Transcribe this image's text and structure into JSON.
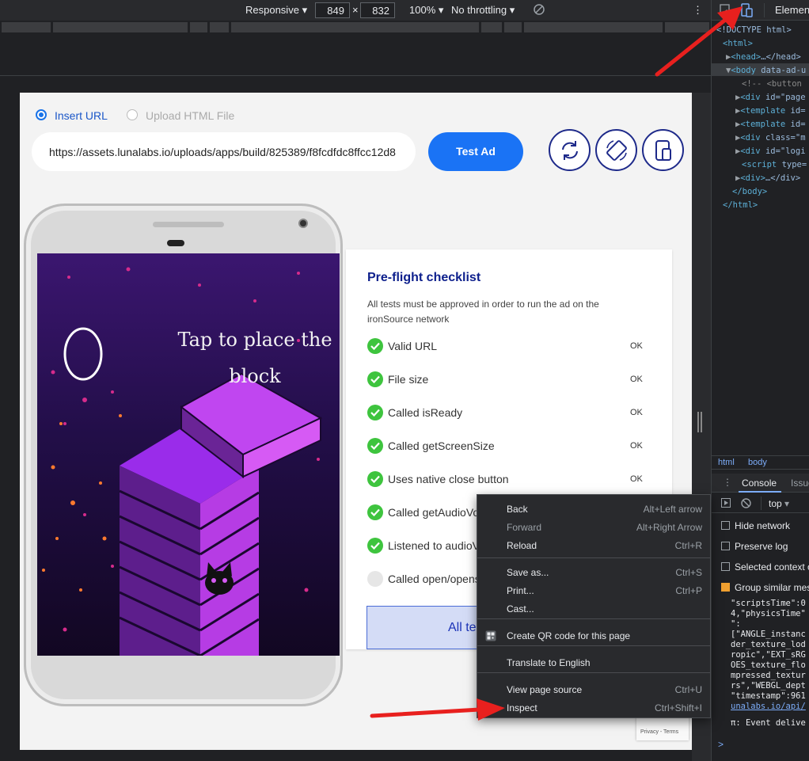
{
  "device_toolbar": {
    "device": "Responsive",
    "width": "849",
    "times": "×",
    "height": "832",
    "zoom": "100%",
    "throttling": "No throttling",
    "more": "⋮"
  },
  "page": {
    "radio_insert_url": "Insert URL",
    "radio_upload_html": "Upload HTML File",
    "url_value": "https://assets.lunalabs.io/uploads/apps/build/825389/f8fcdfdc8ffcc12d8",
    "test_button": "Test Ad",
    "phone_caption": "Tap to place the block",
    "checklist": {
      "title": "Pre-flight checklist",
      "subtitle": "All tests must be approved in order to run the ad on the ironSource network",
      "items": [
        {
          "label": "Valid URL",
          "status": "OK",
          "passed": true
        },
        {
          "label": "File size",
          "status": "OK",
          "passed": true
        },
        {
          "label": "Called isReady",
          "status": "OK",
          "passed": true
        },
        {
          "label": "Called getScreenSize",
          "status": "OK",
          "passed": true
        },
        {
          "label": "Uses native close button",
          "status": "OK",
          "passed": true
        },
        {
          "label": "Called getAudioVo",
          "status": "",
          "passed": true
        },
        {
          "label": "Listened to audioV",
          "status": "",
          "passed": true
        },
        {
          "label": "Called open/opens",
          "status": "",
          "passed": false
        }
      ],
      "all_tests_button": "All te"
    },
    "recaptcha_terms": "Privacy - Terms"
  },
  "context_menu": {
    "items": [
      {
        "label": "Back",
        "shortcut": "Alt+Left arrow"
      },
      {
        "label": "Forward",
        "shortcut": "Alt+Right Arrow",
        "disabled": true
      },
      {
        "label": "Reload",
        "shortcut": "Ctrl+R"
      },
      {
        "label": "Save as...",
        "shortcut": "Ctrl+S"
      },
      {
        "label": "Print...",
        "shortcut": "Ctrl+P"
      },
      {
        "label": "Cast...",
        "shortcut": ""
      },
      {
        "label": "Create QR code for this page",
        "shortcut": ""
      },
      {
        "label": "Translate to English",
        "shortcut": ""
      },
      {
        "label": "View page source",
        "shortcut": "Ctrl+U"
      },
      {
        "label": "Inspect",
        "shortcut": "Ctrl+Shift+I"
      }
    ]
  },
  "devtools": {
    "tab_elements": "Elements",
    "dom_lines": [
      {
        "open": "",
        "tag": "",
        "text": "<!DOCTYPE html>"
      },
      {
        "open": "",
        "tag": "<html>",
        "text": ""
      },
      {
        "open": "▶",
        "tag": "<head>",
        "text": "…</head>"
      },
      {
        "open": "▼",
        "tag": "<body",
        "text": " data-ad-u"
      },
      {
        "open": "",
        "tag": "",
        "text": "<!-- <button"
      },
      {
        "open": "▶",
        "tag": "<div",
        "text": " id=\"page"
      },
      {
        "open": "▶",
        "tag": "<template",
        "text": " id="
      },
      {
        "open": "▶",
        "tag": "<template",
        "text": " id="
      },
      {
        "open": "▶",
        "tag": "<div",
        "text": " class=\"m"
      },
      {
        "open": "▶",
        "tag": "<div",
        "text": " id=\"logi"
      },
      {
        "open": "",
        "tag": "<script",
        "text": " type="
      },
      {
        "open": "▶",
        "tag": "<div>",
        "text": "…</div>"
      },
      {
        "open": "",
        "tag": "</body>",
        "text": ""
      },
      {
        "open": "",
        "tag": "</html>",
        "text": ""
      }
    ],
    "crumbs": [
      "html",
      "body"
    ],
    "console_tab": "Console",
    "issues_tab": "Issue",
    "context": "top",
    "checkboxes": [
      {
        "label": "Hide network",
        "checked": false
      },
      {
        "label": "Preserve log",
        "checked": false
      },
      {
        "label": "Selected context o",
        "checked": false
      },
      {
        "label": "Group similar mes",
        "checked": true
      }
    ],
    "console_lines": [
      "\"scriptsTime\":0",
      "4,\"physicsTime\"",
      "\":",
      "[\"ANGLE_instanc",
      "der_texture_lod",
      "ropic\",\"EXT_sRG",
      "OES_texture_flo",
      "mpressed_textur",
      "rs\",\"WEBGL_dept",
      "\"timestamp\":961"
    ],
    "console_link": "unalabs.io/api/",
    "console_event": "π: Event delive",
    "prompt": ">"
  },
  "colors": {
    "accent_blue": "#1a73f5",
    "check_green": "#3ec43e",
    "annotation_red": "#e8201e"
  }
}
